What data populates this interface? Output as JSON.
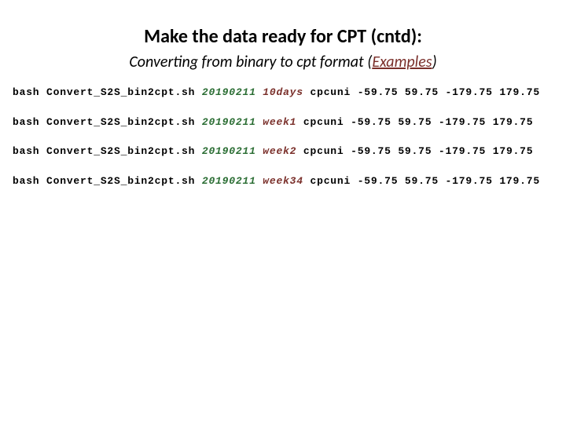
{
  "title": "Make the data ready for CPT  (cntd):",
  "subtitle_prefix": "Converting from binary to cpt format (",
  "subtitle_examples": "Examples",
  "subtitle_suffix": ")",
  "commands": [
    {
      "bash": "bash",
      "script": "Convert_S2S_bin2cpt.sh",
      "date": "20190211",
      "range": "10days",
      "rest": "cpcuni -59.75  59.75 -179.75 179.75"
    },
    {
      "bash": "bash",
      "script": "Convert_S2S_bin2cpt.sh",
      "date": "20190211",
      "range": "week1",
      "rest": "cpcuni -59.75  59.75 -179.75 179.75"
    },
    {
      "bash": "bash",
      "script": "Convert_S2S_bin2cpt.sh",
      "date": "20190211",
      "range": "week2",
      "rest": "cpcuni -59.75  59.75 -179.75 179.75"
    },
    {
      "bash": "bash",
      "script": "Convert_S2S_bin2cpt.sh",
      "date": "20190211",
      "range": "week34",
      "rest": "cpcuni -59.75  59.75 -179.75 179.75"
    }
  ]
}
